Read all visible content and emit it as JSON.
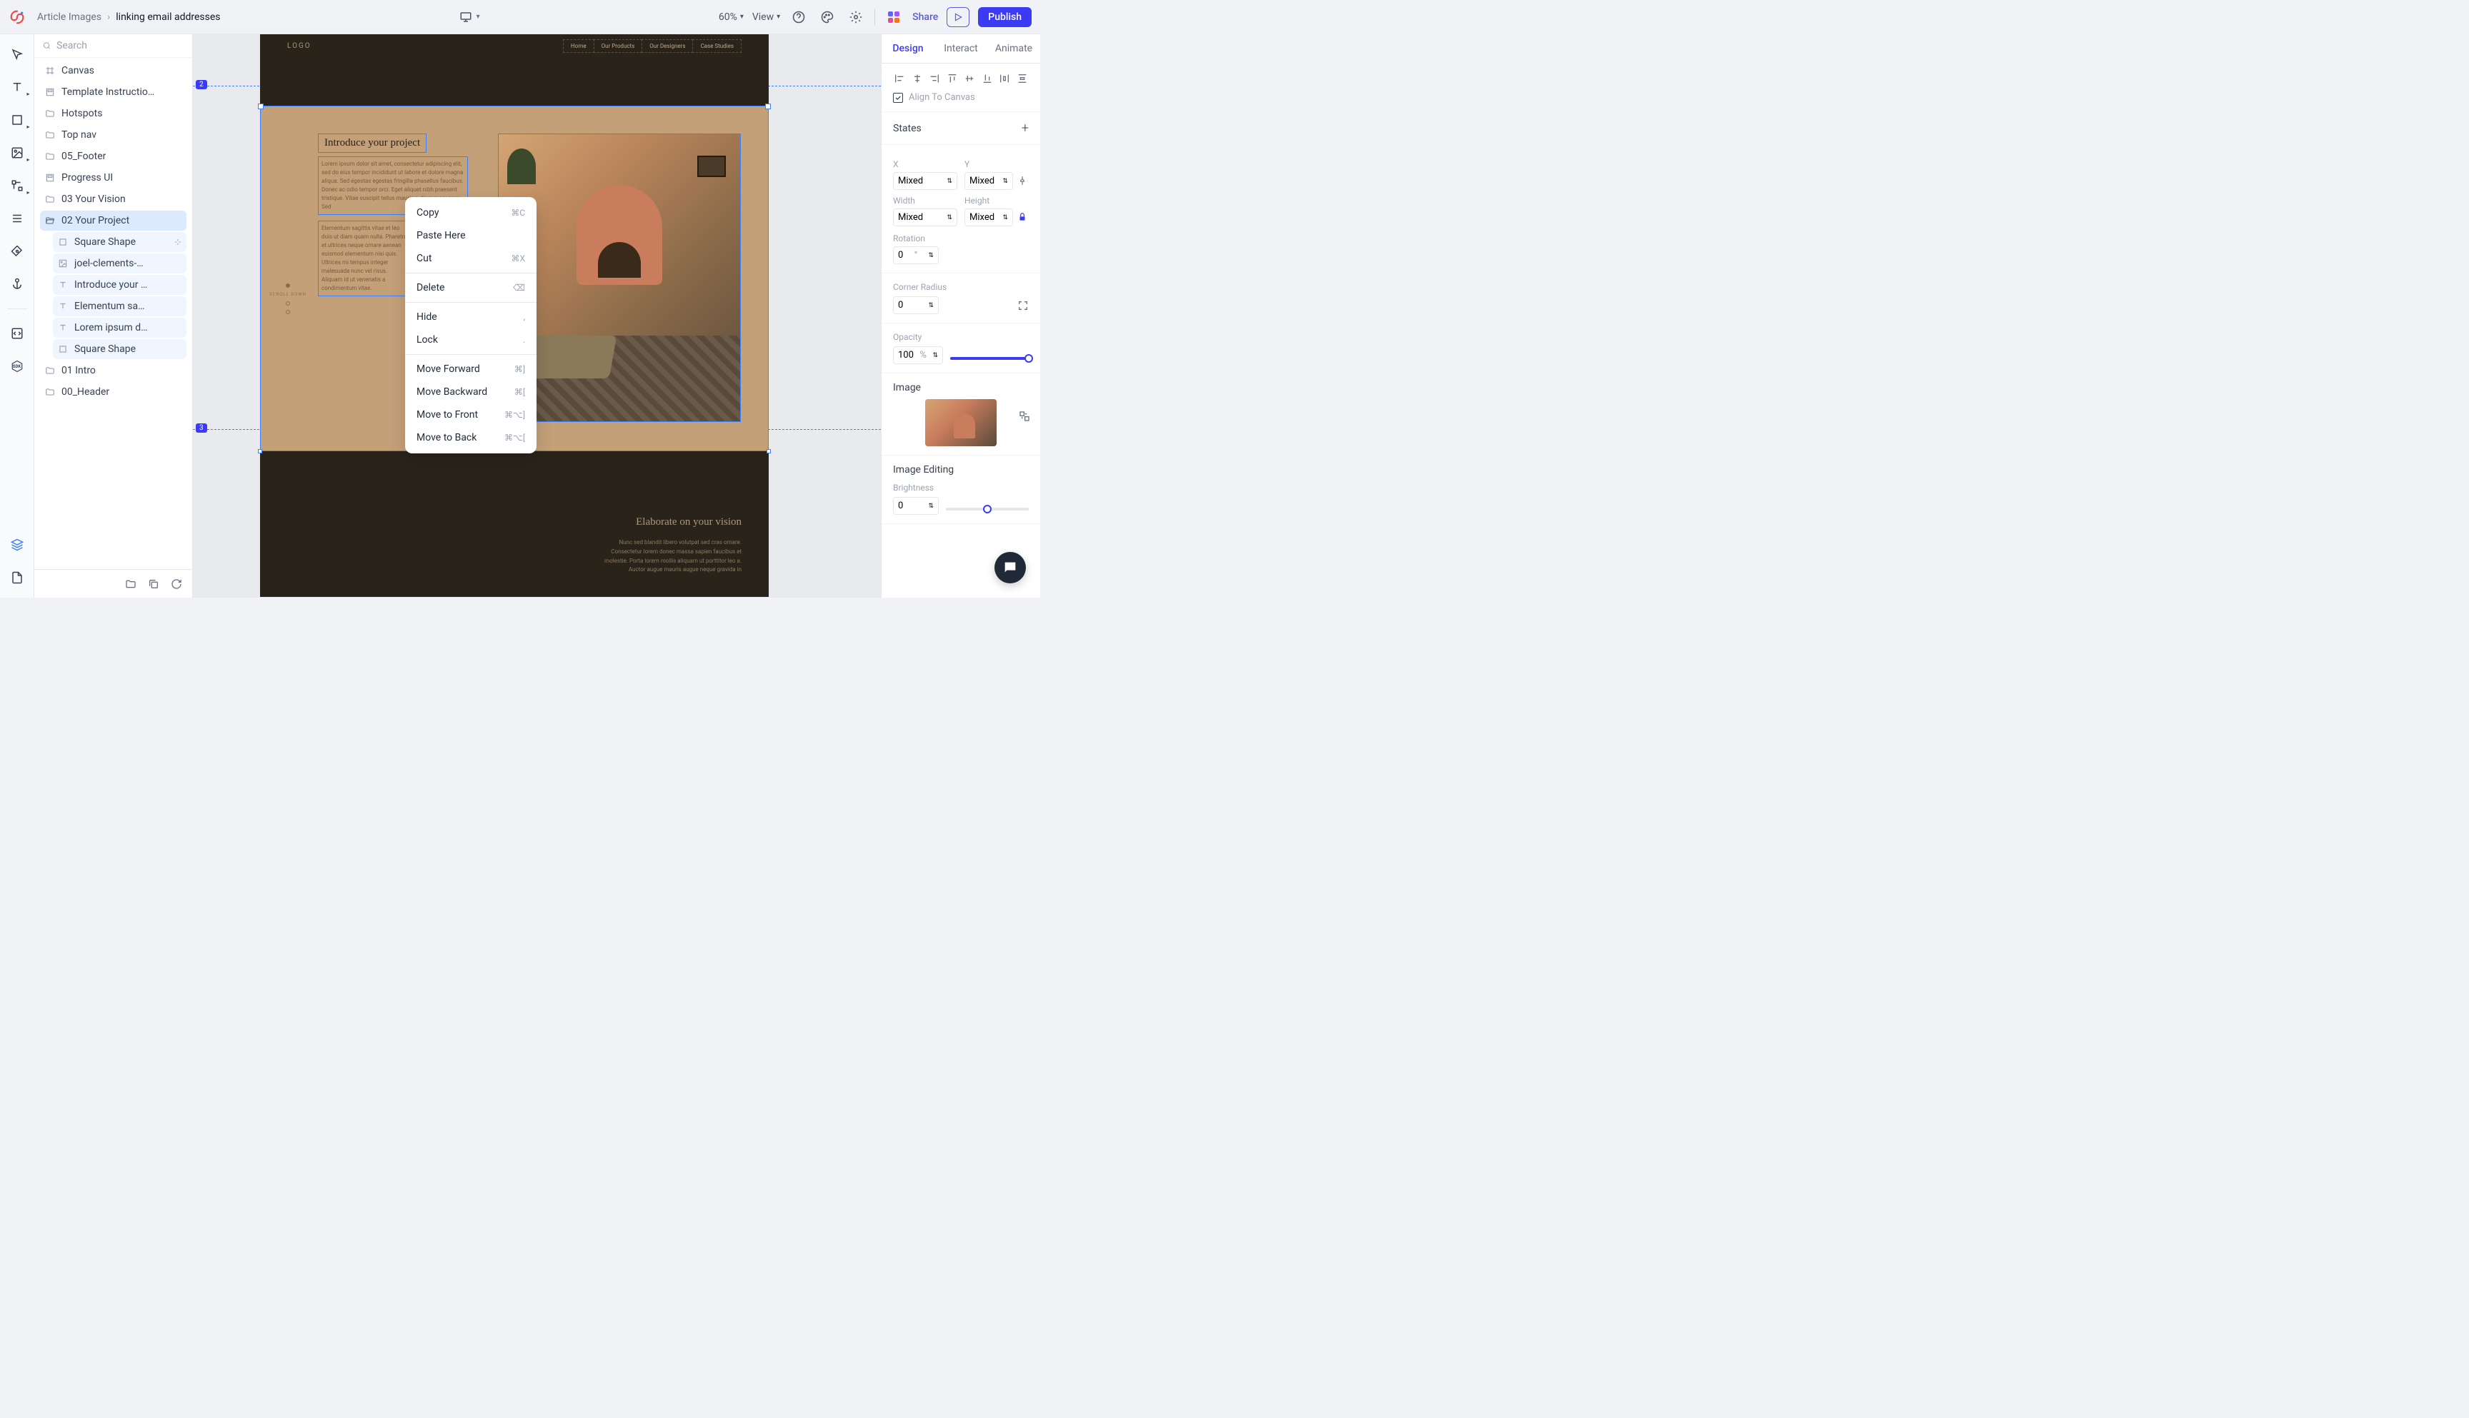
{
  "breadcrumb": {
    "parent": "Article Images",
    "current": "linking email addresses"
  },
  "topbar": {
    "zoom": "60%",
    "view": "View",
    "share": "Share",
    "publish": "Publish"
  },
  "search": {
    "placeholder": "Search"
  },
  "layers": {
    "items": [
      {
        "label": "Canvas",
        "icon": "frame"
      },
      {
        "label": "Template Instructio…",
        "icon": "template"
      },
      {
        "label": "Hotspots",
        "icon": "folder"
      },
      {
        "label": "Top nav",
        "icon": "folder"
      },
      {
        "label": "05_Footer",
        "icon": "folder"
      },
      {
        "label": "Progress UI",
        "icon": "template"
      },
      {
        "label": "03 Your Vision",
        "icon": "folder"
      },
      {
        "label": "02 Your Project",
        "icon": "folder-open",
        "selected": true
      },
      {
        "label": "Square Shape",
        "icon": "square",
        "child": true,
        "broken": true
      },
      {
        "label": "joel-clements-…",
        "icon": "image",
        "child": true
      },
      {
        "label": "Introduce your …",
        "icon": "text",
        "child": true
      },
      {
        "label": "Elementum sa…",
        "icon": "text",
        "child": true
      },
      {
        "label": "Lorem ipsum d…",
        "icon": "text",
        "child": true
      },
      {
        "label": "Square Shape",
        "icon": "square",
        "child": true
      },
      {
        "label": "01 Intro",
        "icon": "folder"
      },
      {
        "label": "00_Header",
        "icon": "folder"
      }
    ]
  },
  "canvas": {
    "logo": "LOGO",
    "nav": [
      "Home",
      "Our Products",
      "Our Designers",
      "Case Studies"
    ],
    "intro_title": "Introduce your project",
    "intro_para": "Lorem ipsum dolor sit amet, consectetur adipiscing elit, sed do eius tempor incididunt ut labore et dolore magna aliqua. Sed egestas egestas fringilla phasellus faucibus. Donec ac odio tempor orci. Eget aliquet nibh praesent tristique. Vitae suscipit tellus mauris a diam maecenas. Sed",
    "intro_para2": "Elementum sagittis vitae et leo duis ut diam quam nulla. Pharetra et ultrices neque ornare aenean euismod elementum nisi quis. Ultrices mi tempus integer malesuada nunc vel risus. Aliquam id ut venenatis a condimentum vitae.",
    "scroll": "SCROLL DOWN",
    "vision_title": "Elaborate on your vision",
    "vision_para": "Nunc sed blandit libero volutpat sed cras ornare. Consectetur lorem donec massa sapien faucibus et molestie. Porta lorem mollis aliquam ut porttitor leo a. Auctor augue mauris augue neque gravida in",
    "badges": {
      "top": "2",
      "bottom": "3"
    }
  },
  "context_menu": {
    "items": [
      {
        "label": "Copy",
        "shortcut": "⌘C"
      },
      {
        "label": "Paste Here",
        "shortcut": ""
      },
      {
        "label": "Cut",
        "shortcut": "⌘X"
      },
      {
        "divider": true
      },
      {
        "label": "Delete",
        "shortcut": "⌫"
      },
      {
        "divider": true
      },
      {
        "label": "Hide",
        "shortcut": ","
      },
      {
        "label": "Lock",
        "shortcut": "."
      },
      {
        "divider": true
      },
      {
        "label": "Move Forward",
        "shortcut": "⌘]"
      },
      {
        "label": "Move Backward",
        "shortcut": "⌘["
      },
      {
        "label": "Move to Front",
        "shortcut": "⌘⌥]"
      },
      {
        "label": "Move to Back",
        "shortcut": "⌘⌥["
      }
    ]
  },
  "right": {
    "tabs": [
      "Design",
      "Interact",
      "Animate"
    ],
    "align_canvas": "Align To Canvas",
    "states": "States",
    "pos": {
      "x_label": "X",
      "y_label": "Y",
      "x": "Mixed",
      "y": "Mixed"
    },
    "size": {
      "w_label": "Width",
      "h_label": "Height",
      "w": "Mixed",
      "h": "Mixed"
    },
    "rotation": {
      "label": "Rotation",
      "value": "0",
      "unit": "°"
    },
    "corner": {
      "label": "Corner Radius",
      "value": "0"
    },
    "opacity": {
      "label": "Opacity",
      "value": "100",
      "unit": "%"
    },
    "image": {
      "label": "Image"
    },
    "editing": {
      "label": "Image Editing",
      "brightness_label": "Brightness",
      "brightness": "0"
    }
  }
}
